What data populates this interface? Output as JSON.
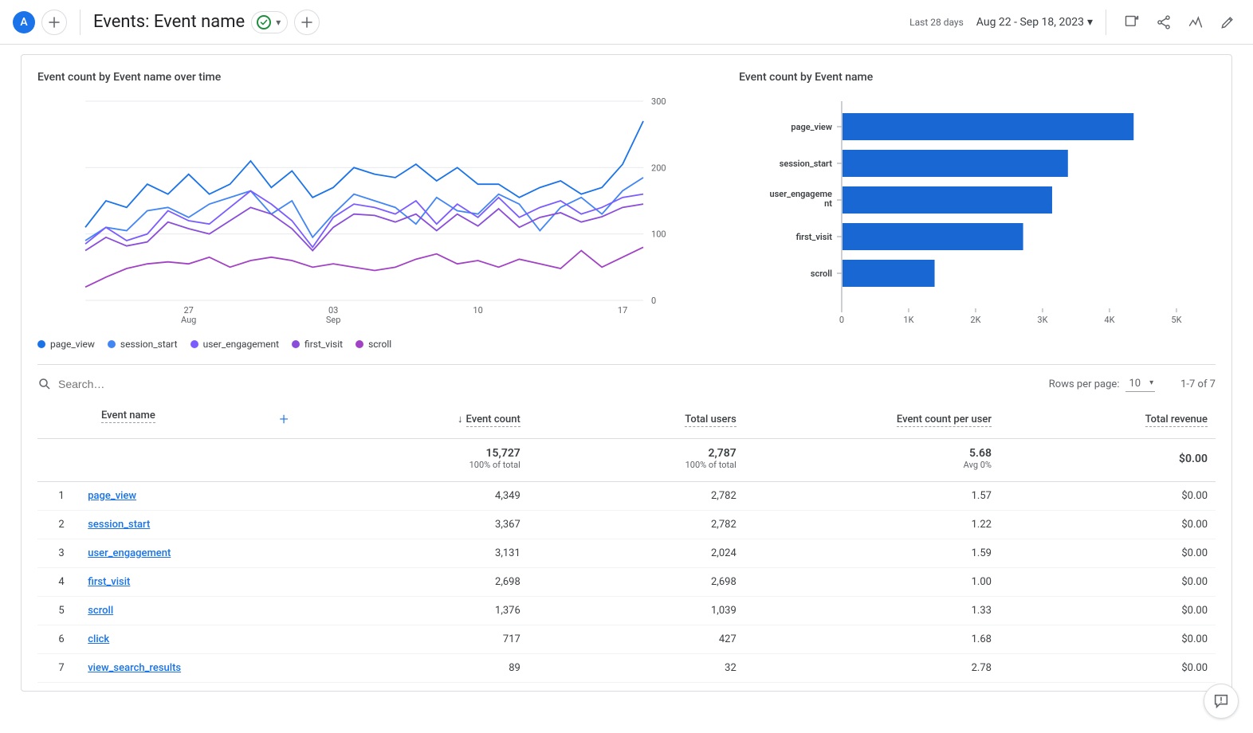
{
  "header": {
    "avatar_letter": "A",
    "page_title": "Events: Event name",
    "date_label": "Last 28 days",
    "date_range": "Aug 22 - Sep 18, 2023"
  },
  "charts": {
    "line_title": "Event count by Event name over time",
    "bar_title": "Event count by Event name",
    "legend": [
      "page_view",
      "session_start",
      "user_engagement",
      "first_visit",
      "scroll"
    ]
  },
  "chart_data": [
    {
      "type": "line",
      "title": "Event count by Event name over time",
      "xlabel": "",
      "ylabel": "",
      "ylim": [
        0,
        300
      ],
      "y_ticks": [
        0,
        100,
        200,
        300
      ],
      "x_tick_labels": [
        "27\nAug",
        "03\nSep",
        "10",
        "17"
      ],
      "series": [
        {
          "name": "page_view",
          "color": "#1a73e8",
          "values": [
            110,
            150,
            140,
            175,
            160,
            190,
            160,
            175,
            210,
            170,
            195,
            155,
            170,
            200,
            190,
            185,
            205,
            180,
            200,
            175,
            175,
            155,
            170,
            180,
            160,
            170,
            205,
            270
          ]
        },
        {
          "name": "session_start",
          "color": "#4285f4",
          "values": [
            90,
            110,
            105,
            135,
            140,
            125,
            145,
            155,
            165,
            130,
            150,
            95,
            130,
            160,
            150,
            140,
            115,
            155,
            135,
            130,
            160,
            145,
            105,
            140,
            155,
            130,
            165,
            185
          ]
        },
        {
          "name": "user_engagement",
          "color": "#7b5cff",
          "values": [
            85,
            110,
            90,
            100,
            135,
            120,
            115,
            140,
            165,
            145,
            120,
            80,
            125,
            145,
            140,
            130,
            150,
            115,
            145,
            125,
            155,
            125,
            140,
            150,
            130,
            140,
            155,
            160
          ]
        },
        {
          "name": "first_visit",
          "color": "#8a4dd9",
          "values": [
            75,
            95,
            82,
            88,
            118,
            108,
            100,
            120,
            140,
            130,
            108,
            75,
            110,
            130,
            128,
            118,
            130,
            105,
            130,
            112,
            138,
            110,
            125,
            132,
            118,
            126,
            140,
            145
          ]
        },
        {
          "name": "scroll",
          "color": "#a142c4",
          "values": [
            20,
            35,
            48,
            55,
            58,
            55,
            65,
            50,
            60,
            65,
            60,
            50,
            55,
            50,
            45,
            50,
            62,
            70,
            55,
            60,
            50,
            62,
            55,
            48,
            75,
            50,
            65,
            80
          ]
        }
      ]
    },
    {
      "type": "bar",
      "orientation": "horizontal",
      "title": "Event count by Event name",
      "xlim": [
        0,
        5000
      ],
      "x_ticks": [
        0,
        1000,
        2000,
        3000,
        4000,
        5000
      ],
      "x_tick_labels": [
        "0",
        "1K",
        "2K",
        "3K",
        "4K",
        "5K"
      ],
      "categories": [
        "page_view",
        "session_start",
        "user_engagement",
        "first_visit",
        "scroll"
      ],
      "values": [
        4349,
        3367,
        3131,
        2698,
        1376
      ],
      "color": "#1967d2"
    }
  ],
  "table": {
    "search_placeholder": "Search…",
    "rows_per_page_label": "Rows per page:",
    "rows_per_page_value": "10",
    "page_info": "1-7 of 7",
    "columns": [
      "Event name",
      "Event count",
      "Total users",
      "Event count per user",
      "Total revenue"
    ],
    "totals": {
      "event_count": "15,727",
      "event_count_sub": "100% of total",
      "total_users": "2,787",
      "total_users_sub": "100% of total",
      "per_user": "5.68",
      "per_user_sub": "Avg 0%",
      "revenue": "$0.00"
    },
    "rows": [
      {
        "idx": "1",
        "name": "page_view",
        "event_count": "4,349",
        "total_users": "2,782",
        "per_user": "1.57",
        "revenue": "$0.00"
      },
      {
        "idx": "2",
        "name": "session_start",
        "event_count": "3,367",
        "total_users": "2,782",
        "per_user": "1.22",
        "revenue": "$0.00"
      },
      {
        "idx": "3",
        "name": "user_engagement",
        "event_count": "3,131",
        "total_users": "2,024",
        "per_user": "1.59",
        "revenue": "$0.00"
      },
      {
        "idx": "4",
        "name": "first_visit",
        "event_count": "2,698",
        "total_users": "2,698",
        "per_user": "1.00",
        "revenue": "$0.00"
      },
      {
        "idx": "5",
        "name": "scroll",
        "event_count": "1,376",
        "total_users": "1,039",
        "per_user": "1.33",
        "revenue": "$0.00"
      },
      {
        "idx": "6",
        "name": "click",
        "event_count": "717",
        "total_users": "427",
        "per_user": "1.68",
        "revenue": "$0.00"
      },
      {
        "idx": "7",
        "name": "view_search_results",
        "event_count": "89",
        "total_users": "32",
        "per_user": "2.78",
        "revenue": "$0.00"
      }
    ]
  }
}
